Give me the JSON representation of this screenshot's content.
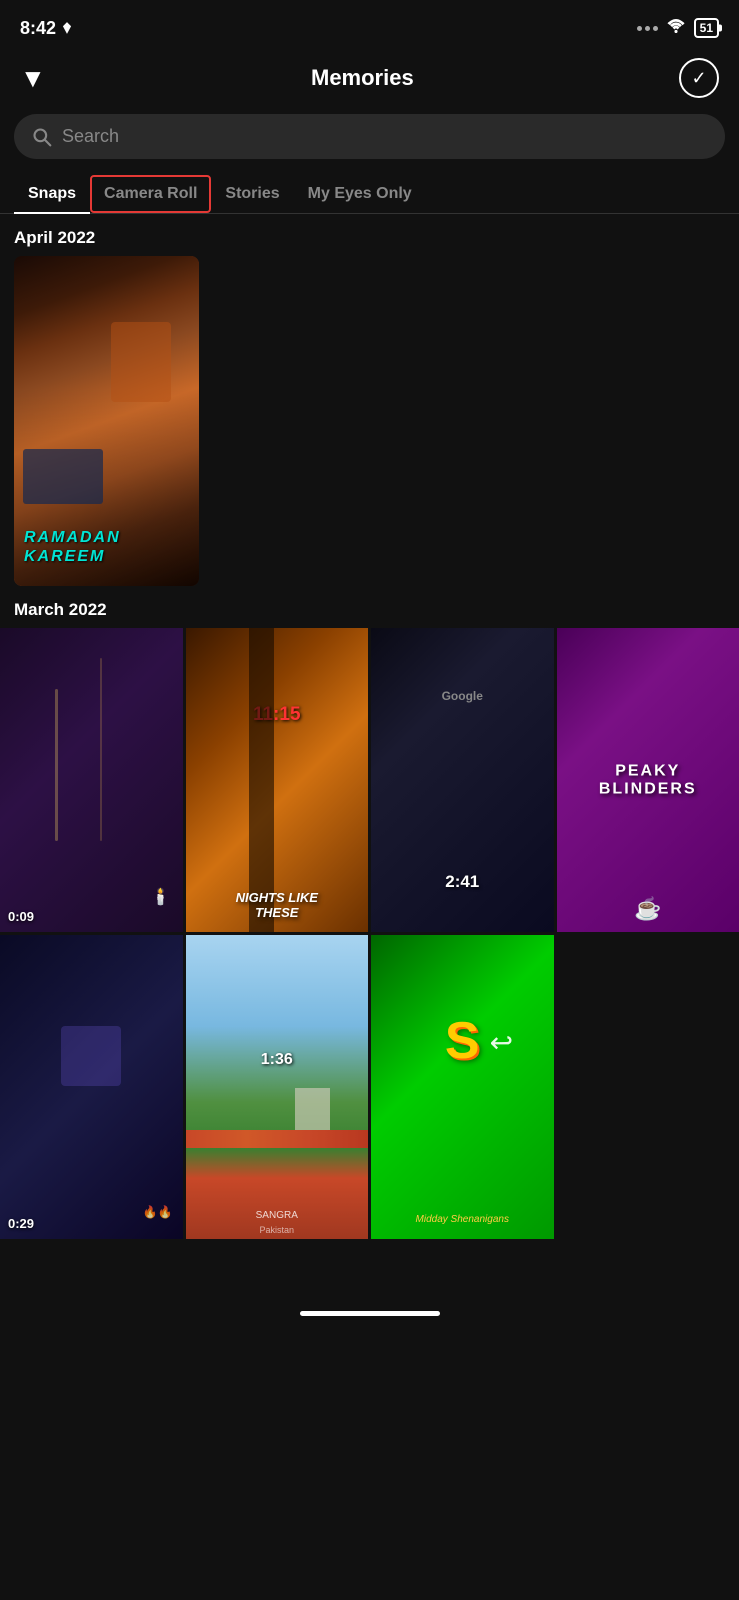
{
  "statusBar": {
    "time": "8:42",
    "battery": "51"
  },
  "header": {
    "title": "Memories",
    "chevronLabel": "▼",
    "checkLabel": "✓"
  },
  "search": {
    "placeholder": "Search"
  },
  "tabs": [
    {
      "id": "snaps",
      "label": "Snaps",
      "active": true,
      "highlighted": false
    },
    {
      "id": "camera-roll",
      "label": "Camera Roll",
      "active": false,
      "highlighted": true
    },
    {
      "id": "stories",
      "label": "Stories",
      "active": false,
      "highlighted": false
    },
    {
      "id": "my-eyes-only",
      "label": "My Eyes Only",
      "active": false,
      "highlighted": false
    }
  ],
  "sections": [
    {
      "id": "april-2022",
      "title": "April 2022"
    },
    {
      "id": "march-2022",
      "title": "March 2022"
    }
  ],
  "aprilSnap": {
    "overlayLine1": "RAMADAN",
    "overlayLine2": "KAREEM"
  },
  "marchThumbs": [
    {
      "id": "m1",
      "duration": "0:09",
      "label": ""
    },
    {
      "id": "m2",
      "timeText": "11:15",
      "overlay": "NIGHTS LIKE THESE"
    },
    {
      "id": "m3",
      "timeText": "2:41",
      "label": ""
    },
    {
      "id": "m4",
      "overlay": "PEAKY BLINDERS"
    },
    {
      "id": "m5",
      "duration": "0:29",
      "label": ""
    },
    {
      "id": "m6",
      "timeText": "1:36",
      "label": "SANGRA",
      "sublabel": "Pakistan"
    },
    {
      "id": "m7",
      "subLabel": "Midday Shenanigans"
    }
  ]
}
